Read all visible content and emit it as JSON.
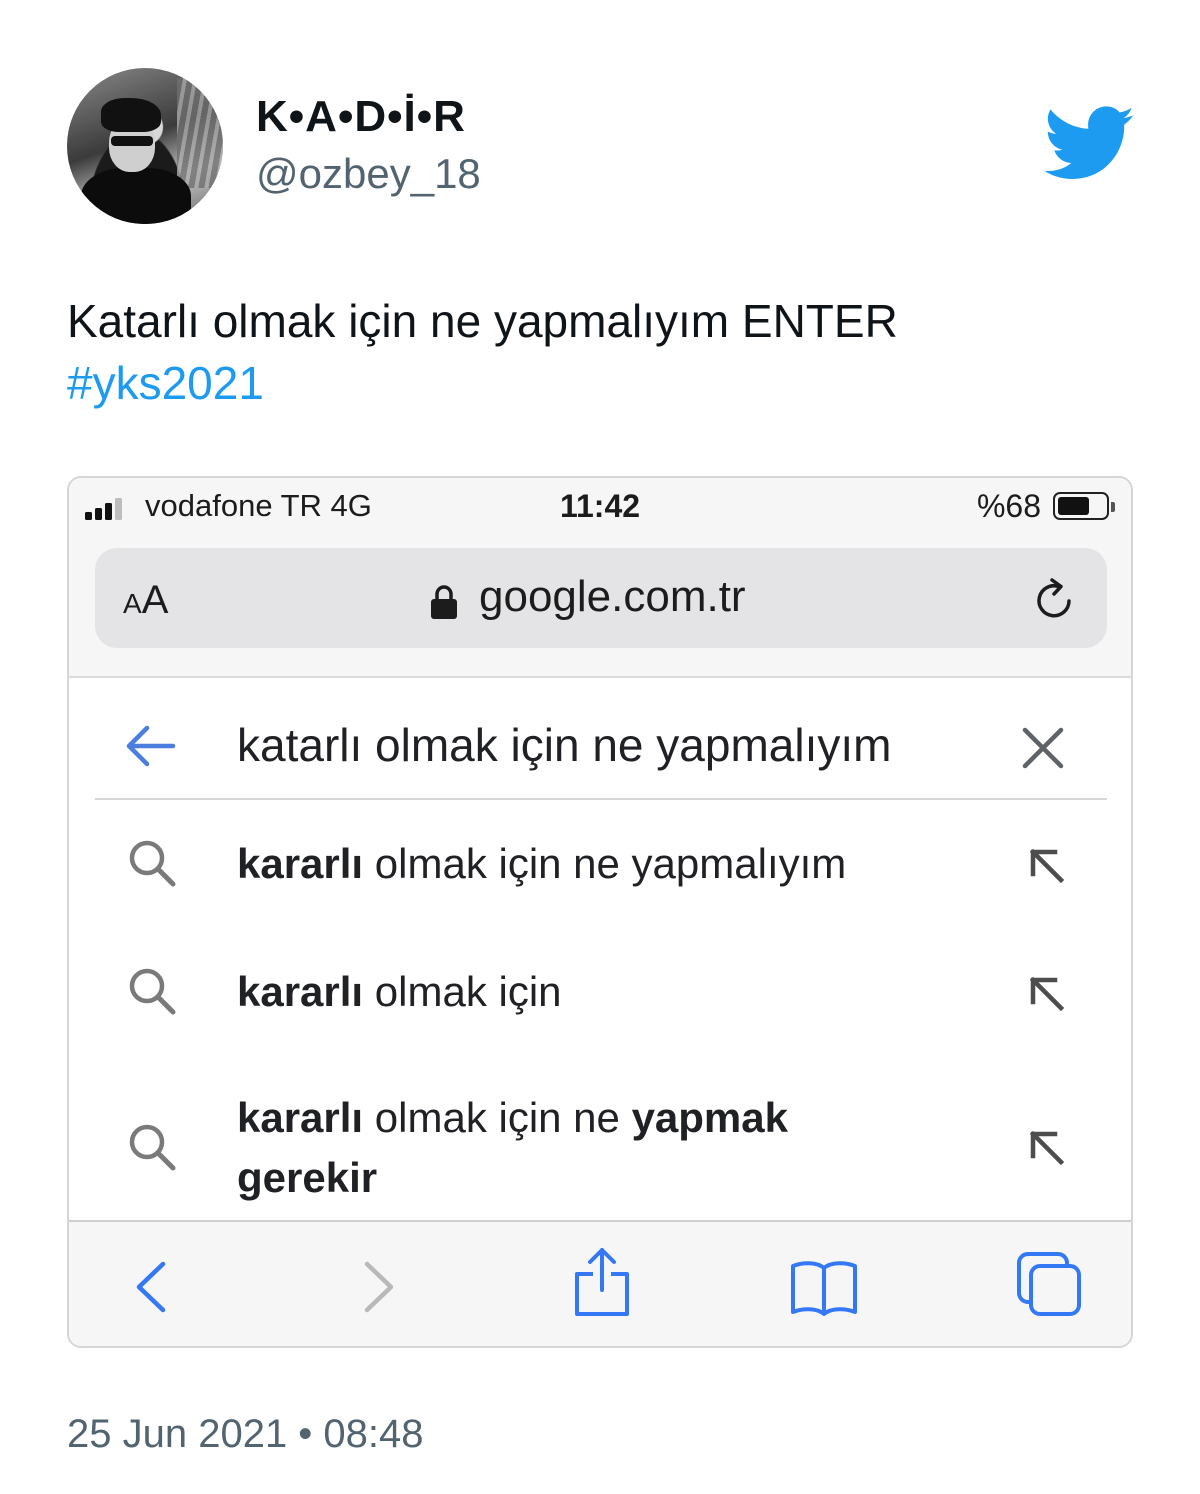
{
  "tweet": {
    "display_name": "K•A•D•İ•R",
    "handle": "@ozbey_18",
    "text": "Katarlı olmak için ne yapmalıyım ENTER",
    "hashtag": "#yks2021",
    "timestamp": "25 Jun 2021 • 08:48",
    "logo_icon": "twitter-bird-icon",
    "brand_color": "#1d9bf0"
  },
  "phone": {
    "status": {
      "carrier": "vodafone TR  4G",
      "time": "11:42",
      "battery": "%68",
      "battery_level": 0.68
    },
    "browser": {
      "text_size_label": "AA",
      "url": "google.com.tr"
    },
    "search": {
      "query": "katarlı olmak için ne yapmalıyım",
      "suggestions": [
        {
          "bold_prefix": "kararlı",
          "rest": " olmak için ne yapmalıyım",
          "bold_suffix": ""
        },
        {
          "bold_prefix": "kararlı",
          "rest": " olmak için",
          "bold_suffix": ""
        },
        {
          "bold_prefix": "kararlı",
          "rest": " olmak için ne ",
          "bold_suffix": "yapmak gerekir"
        }
      ]
    },
    "toolbar_icons": [
      "back-icon",
      "forward-icon",
      "share-icon",
      "bookmarks-icon",
      "tabs-icon"
    ],
    "accent_color": "#3478f6"
  }
}
